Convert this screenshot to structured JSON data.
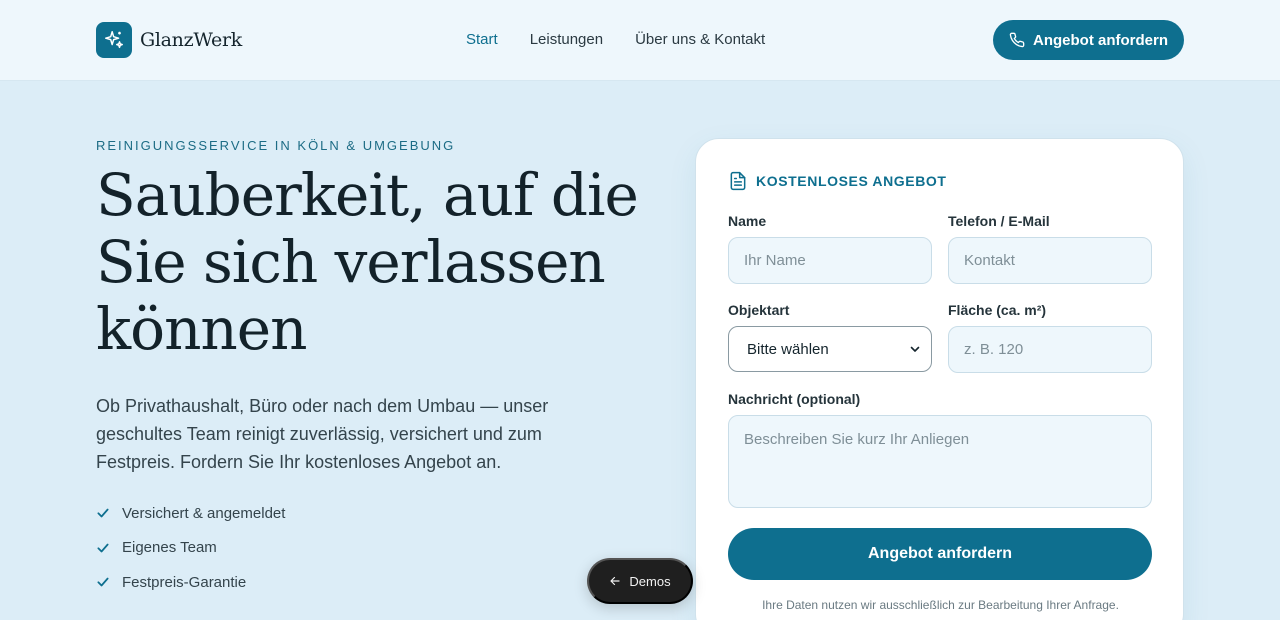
{
  "header": {
    "brand": "GlanzWerk",
    "nav": [
      {
        "label": "Start",
        "active": true
      },
      {
        "label": "Leistungen",
        "active": false
      },
      {
        "label": "Über uns & Kontakt",
        "active": false
      }
    ],
    "cta_label": "Angebot anfordern"
  },
  "hero": {
    "eyebrow": "REINIGUNGSSERVICE IN KÖLN & UMGEBUNG",
    "headline": "Sauberkeit, auf die Sie sich verlassen können",
    "lead": "Ob Privathaushalt, Büro oder nach dem Umbau — unser geschultes Team reinigt zuverlässig, versichert und zum Festpreis. Fordern Sie Ihr kostenloses Angebot an.",
    "features": [
      "Versichert & angemeldet",
      "Eigenes Team",
      "Festpreis-Garantie"
    ]
  },
  "form": {
    "title": "KOSTENLOSES ANGEBOT",
    "name_label": "Name",
    "name_placeholder": "Ihr Name",
    "contact_label": "Telefon / E-Mail",
    "contact_placeholder": "Kontakt",
    "type_label": "Objektart",
    "type_value": "Bitte wählen",
    "area_label": "Fläche (ca. m²)",
    "area_placeholder": "z. B. 120",
    "message_label": "Nachricht (optional)",
    "message_placeholder": "Beschreiben Sie kurz Ihr Anliegen",
    "submit_label": "Angebot anfordern",
    "privacy": "Ihre Daten nutzen wir ausschließlich zur Bearbeitung Ihrer Anfrage."
  },
  "demos_label": "Demos",
  "colors": {
    "accent": "#0e6f8f",
    "background": "#dcedf7",
    "header_bg": "#eef7fc"
  },
  "icons": {
    "logo": "sparkle-icon",
    "cta": "phone-icon",
    "form_title": "document-icon",
    "feature": "check-icon",
    "demos": "arrow-left-icon",
    "select": "chevron-down-icon"
  }
}
